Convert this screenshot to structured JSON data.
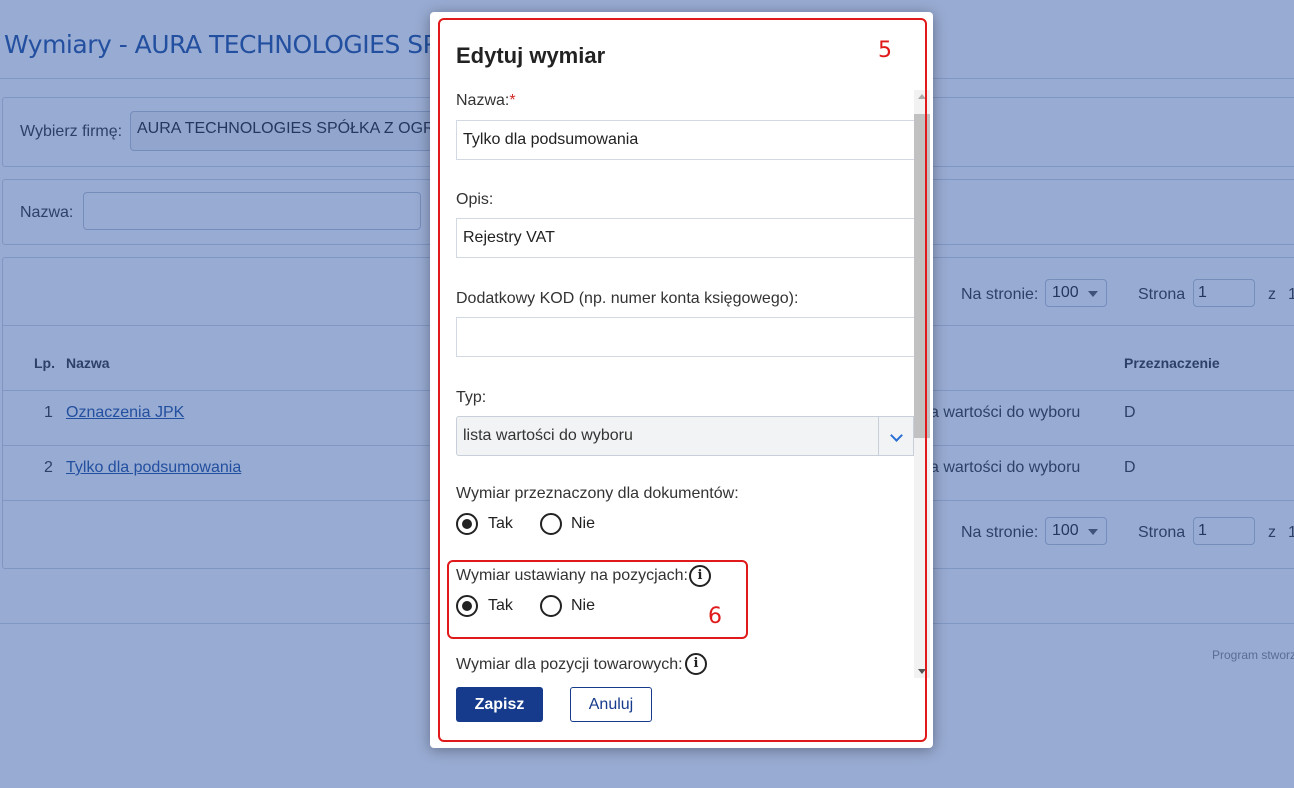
{
  "page": {
    "title": "Wymiary - AURA TECHNOLOGIES SPÓŁKA Z",
    "company_label": "Wybierz firmę:",
    "company_value": "AURA TECHNOLOGIES SPÓŁKA Z OGR",
    "name_filter_label": "Nazwa:",
    "per_page_label": "Na stronie:",
    "per_page_value": "100",
    "page_label": "Strona",
    "page_value": "1",
    "page_of": "z",
    "page_total": "1",
    "table": {
      "headers": {
        "lp": "Lp.",
        "name": "Nazwa",
        "purpose": "Przeznaczenie"
      },
      "rows": [
        {
          "lp": "1",
          "name": "Oznaczenia JPK",
          "type": "a wartości do wyboru",
          "purpose": "D"
        },
        {
          "lp": "2",
          "name": "Tylko dla podsumowania",
          "type": "a wartości do wyboru",
          "purpose": "D"
        }
      ]
    },
    "footer_note": "Program stworz"
  },
  "modal": {
    "title": "Edytuj wymiar",
    "name_label": "Nazwa:",
    "required_mark": "*",
    "name_value": "Tylko dla podsumowania",
    "desc_label": "Opis:",
    "desc_value": "Rejestry VAT",
    "code_label": "Dodatkowy KOD (np. numer konta księgowego):",
    "code_value": "",
    "type_label": "Typ:",
    "type_value": "lista wartości do wyboru",
    "for_documents_label": "Wymiar przeznaczony dla dokumentów:",
    "for_positions_label": "Wymiar ustawiany na pozycjach:",
    "goods_positions_label": "Wymiar dla pozycji towarowych:",
    "yes": "Tak",
    "no": "Nie",
    "for_documents_value": "Tak",
    "for_positions_value": "Tak",
    "save_label": "Zapisz",
    "cancel_label": "Anuluj"
  },
  "annotations": {
    "box1": "5",
    "box2": "6",
    "color": "#e01a1a"
  },
  "colors": {
    "brand": "#163b8c",
    "link": "#1d4f9e",
    "overlay": "rgba(40,80,160,0.48)"
  }
}
